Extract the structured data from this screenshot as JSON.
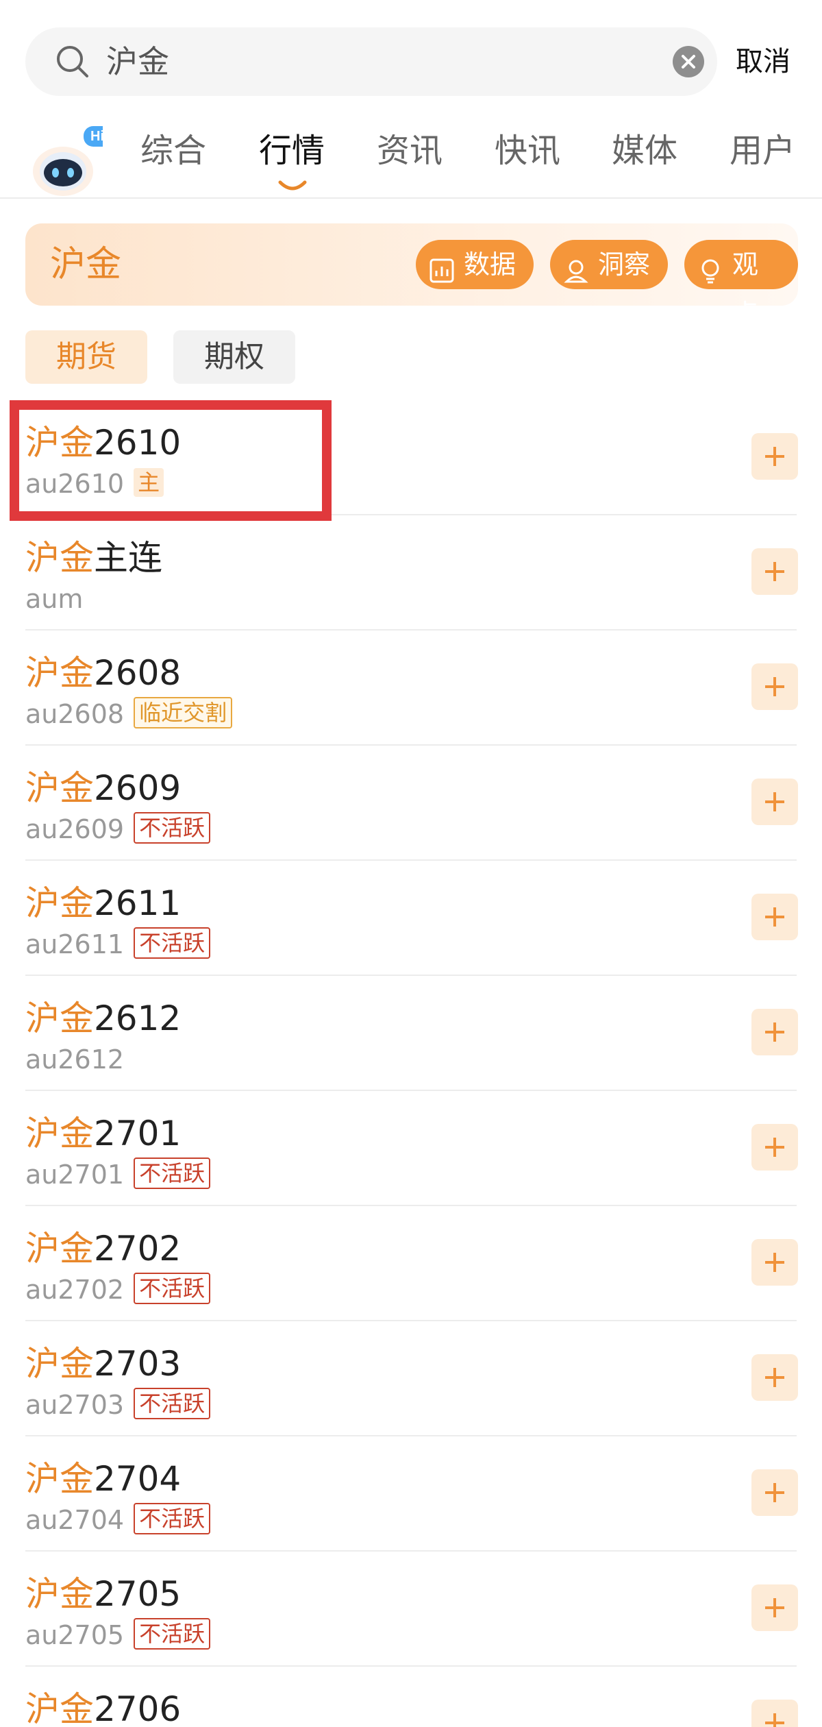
{
  "search": {
    "query": "沪金",
    "cancel_label": "取消"
  },
  "assistant": {
    "badge": "Hi"
  },
  "tabs": [
    {
      "label": "综合",
      "active": false
    },
    {
      "label": "行情",
      "active": true
    },
    {
      "label": "资讯",
      "active": false
    },
    {
      "label": "快讯",
      "active": false
    },
    {
      "label": "媒体",
      "active": false
    },
    {
      "label": "用户",
      "active": false
    }
  ],
  "banner": {
    "title": "沪金",
    "buttons": [
      {
        "label": "数据",
        "icon": "chart-icon"
      },
      {
        "label": "洞察",
        "icon": "insight-icon"
      },
      {
        "label": "观点",
        "icon": "bulb-icon"
      }
    ]
  },
  "filters": {
    "futures": "期货",
    "options": "期权",
    "active": "期货"
  },
  "list": [
    {
      "name_hl": "沪金",
      "name_rest": "2610",
      "code": "au2610",
      "tag": "主",
      "tag_type": "main"
    },
    {
      "name_hl": "沪金",
      "name_rest": "主连",
      "code": "aum",
      "tag": "",
      "tag_type": ""
    },
    {
      "name_hl": "沪金",
      "name_rest": "2608",
      "code": "au2608",
      "tag": "临近交割",
      "tag_type": "near"
    },
    {
      "name_hl": "沪金",
      "name_rest": "2609",
      "code": "au2609",
      "tag": "不活跃",
      "tag_type": "inactive"
    },
    {
      "name_hl": "沪金",
      "name_rest": "2611",
      "code": "au2611",
      "tag": "不活跃",
      "tag_type": "inactive"
    },
    {
      "name_hl": "沪金",
      "name_rest": "2612",
      "code": "au2612",
      "tag": "",
      "tag_type": ""
    },
    {
      "name_hl": "沪金",
      "name_rest": "2701",
      "code": "au2701",
      "tag": "不活跃",
      "tag_type": "inactive"
    },
    {
      "name_hl": "沪金",
      "name_rest": "2702",
      "code": "au2702",
      "tag": "不活跃",
      "tag_type": "inactive"
    },
    {
      "name_hl": "沪金",
      "name_rest": "2703",
      "code": "au2703",
      "tag": "不活跃",
      "tag_type": "inactive"
    },
    {
      "name_hl": "沪金",
      "name_rest": "2704",
      "code": "au2704",
      "tag": "不活跃",
      "tag_type": "inactive"
    },
    {
      "name_hl": "沪金",
      "name_rest": "2705",
      "code": "au2705",
      "tag": "不活跃",
      "tag_type": "inactive"
    },
    {
      "name_hl": "沪金",
      "name_rest": "2706",
      "code": "",
      "tag": "",
      "tag_type": ""
    }
  ],
  "colors": {
    "accent": "#e8872a",
    "inactive_tag": "#c8412b",
    "highlight_box": "#e0393c"
  }
}
